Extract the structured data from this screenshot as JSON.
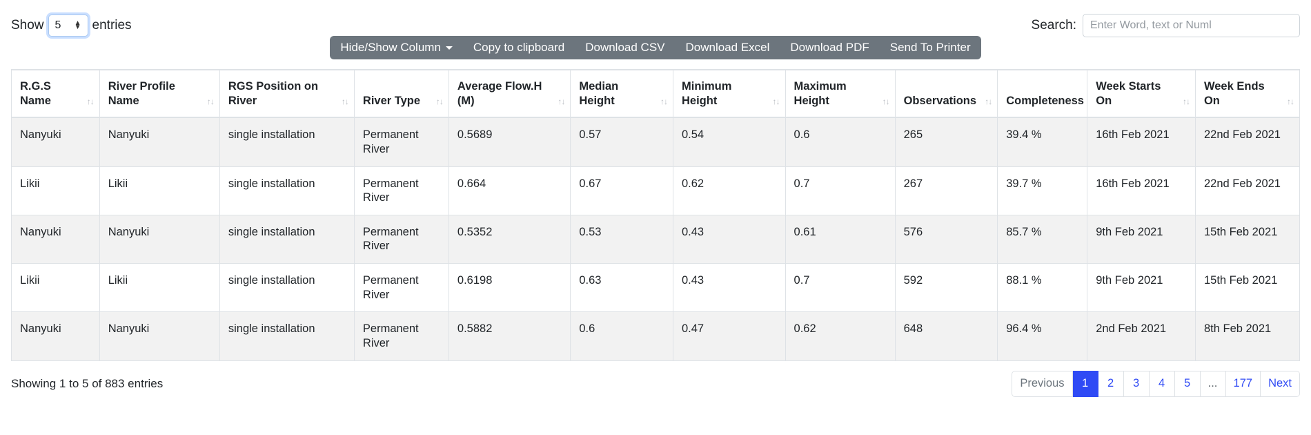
{
  "controls": {
    "show_label": "Show",
    "entries_label": "entries",
    "page_length": "5",
    "search_label": "Search:",
    "search_value": "",
    "search_placeholder": "Enter Word, text or Numl"
  },
  "toolbar": {
    "buttons": [
      {
        "label": "Hide/Show Column",
        "has_caret": true
      },
      {
        "label": "Copy to clipboard",
        "has_caret": false
      },
      {
        "label": "Download CSV",
        "has_caret": false
      },
      {
        "label": "Download Excel",
        "has_caret": false
      },
      {
        "label": "Download PDF",
        "has_caret": false
      },
      {
        "label": "Send To Printer",
        "has_caret": false
      }
    ]
  },
  "table": {
    "columns": [
      {
        "label": "R.G.S Name",
        "sortable": true
      },
      {
        "label": "River Profile Name",
        "sortable": true
      },
      {
        "label": "RGS Position on River",
        "sortable": true
      },
      {
        "label": "River Type",
        "sortable": true
      },
      {
        "label": "Average Flow.H (M)",
        "sortable": true
      },
      {
        "label": "Median Height",
        "sortable": true
      },
      {
        "label": "Minimum Height",
        "sortable": true
      },
      {
        "label": "Maximum Height",
        "sortable": true
      },
      {
        "label": "Observations",
        "sortable": true
      },
      {
        "label": "Completeness",
        "sortable": false
      },
      {
        "label": "Week Starts On",
        "sortable": true
      },
      {
        "label": "Week Ends On",
        "sortable": true
      }
    ],
    "sort_icon": "↑↓",
    "rows": [
      [
        "Nanyuki",
        "Nanyuki",
        "single installation",
        "Permanent River",
        "0.5689",
        "0.57",
        "0.54",
        "0.6",
        "265",
        "39.4 %",
        "16th Feb 2021",
        "22nd Feb 2021"
      ],
      [
        "Likii",
        "Likii",
        "single installation",
        "Permanent River",
        "0.664",
        "0.67",
        "0.62",
        "0.7",
        "267",
        "39.7 %",
        "16th Feb 2021",
        "22nd Feb 2021"
      ],
      [
        "Nanyuki",
        "Nanyuki",
        "single installation",
        "Permanent River",
        "0.5352",
        "0.53",
        "0.43",
        "0.61",
        "576",
        "85.7 %",
        "9th Feb 2021",
        "15th Feb 2021"
      ],
      [
        "Likii",
        "Likii",
        "single installation",
        "Permanent River",
        "0.6198",
        "0.63",
        "0.43",
        "0.7",
        "592",
        "88.1 %",
        "9th Feb 2021",
        "15th Feb 2021"
      ],
      [
        "Nanyuki",
        "Nanyuki",
        "single installation",
        "Permanent River",
        "0.5882",
        "0.6",
        "0.47",
        "0.62",
        "648",
        "96.4 %",
        "2nd Feb 2021",
        "8th Feb 2021"
      ]
    ]
  },
  "footer": {
    "info": "Showing 1 to 5 of 883 entries",
    "pagination": [
      {
        "label": "Previous",
        "active": false,
        "kind": "prev"
      },
      {
        "label": "1",
        "active": true,
        "kind": "page"
      },
      {
        "label": "2",
        "active": false,
        "kind": "page"
      },
      {
        "label": "3",
        "active": false,
        "kind": "page"
      },
      {
        "label": "4",
        "active": false,
        "kind": "page"
      },
      {
        "label": "5",
        "active": false,
        "kind": "page"
      },
      {
        "label": "...",
        "active": false,
        "kind": "dots"
      },
      {
        "label": "177",
        "active": false,
        "kind": "page"
      },
      {
        "label": "Next",
        "active": false,
        "kind": "next"
      }
    ]
  },
  "colors": {
    "toolbar_bg": "#6c757d",
    "pagination_active": "#2f4af5",
    "link": "#2f4af5",
    "row_stripe": "#f2f2f2"
  }
}
